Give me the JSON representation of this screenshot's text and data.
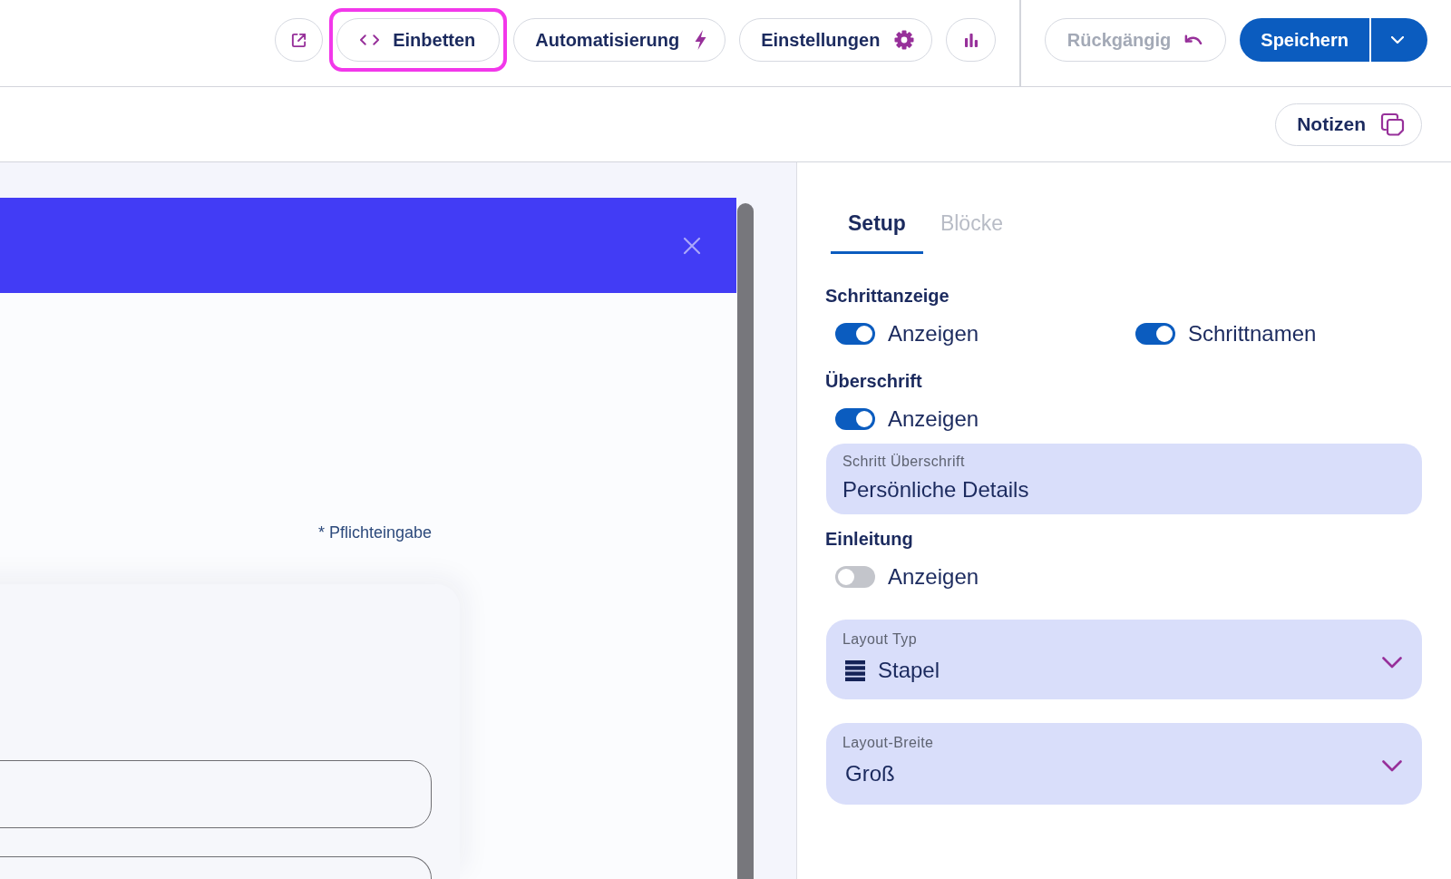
{
  "toolbar": {
    "buttons": [
      {
        "label": "Einbetten",
        "highlighted": true
      },
      {
        "label": "Automatisierung",
        "highlighted": false
      },
      {
        "label": "Einstellungen",
        "highlighted": false
      }
    ],
    "undo": {
      "label": "Rückgängig",
      "disabled": true
    },
    "save": {
      "label": "Speichern"
    }
  },
  "subbar": {
    "notes_button": {
      "label": "Notizen"
    }
  },
  "preview": {
    "required_note": "* Pflichteingabe"
  },
  "panel": {
    "tabs": [
      {
        "label": "Setup",
        "selected": true
      },
      {
        "label": "Blöcke",
        "selected": false
      }
    ],
    "sections": [
      {
        "heading": "Schrittanzeige",
        "toggles": [
          {
            "label": "Anzeigen",
            "on": true
          },
          {
            "label": "Schrittnamen",
            "on": true
          }
        ]
      },
      {
        "heading": "Überschrift",
        "toggles": [
          {
            "label": "Anzeigen",
            "on": true
          }
        ],
        "field": {
          "label": "Schritt Überschrift",
          "value": "Persönliche Details"
        }
      },
      {
        "heading": "Einleitung",
        "toggles": [
          {
            "label": "Anzeigen",
            "on": false
          }
        ]
      }
    ],
    "selects": [
      {
        "label": "Layout Typ",
        "value": "Stapel"
      },
      {
        "label": "Layout-Breite",
        "value": "Groß"
      }
    ]
  }
}
